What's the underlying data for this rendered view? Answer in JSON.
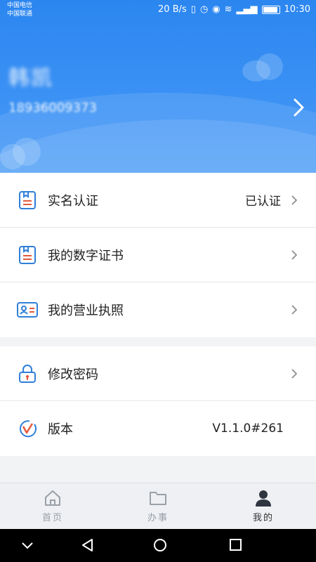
{
  "status_bar": {
    "carrier1": "中国电信",
    "carrier2": "中国联通",
    "speed": "20 B/s",
    "time": "10:30"
  },
  "profile": {
    "name": "韩凯",
    "phone": "18936009373"
  },
  "menu_group1": [
    {
      "label": "实名认证",
      "value": "已认证",
      "icon": "id-badge-icon"
    },
    {
      "label": "我的数字证书",
      "value": "",
      "icon": "certificate-icon"
    },
    {
      "label": "我的营业执照",
      "value": "",
      "icon": "license-card-icon"
    }
  ],
  "menu_group2": [
    {
      "label": "修改密码",
      "value": "",
      "icon": "lock-icon"
    },
    {
      "label": "版本",
      "value": "V1.1.0#261",
      "icon": "version-logo-icon"
    }
  ],
  "tabs": [
    {
      "label": "首页",
      "icon": "home-icon",
      "active": false
    },
    {
      "label": "办事",
      "icon": "folder-icon",
      "active": false
    },
    {
      "label": "我的",
      "icon": "user-icon",
      "active": true
    }
  ],
  "colors": {
    "header_blue": "#3b91f4",
    "icon_blue": "#2f7fd8",
    "icon_red": "#e35a3c",
    "active_tab": "#2f3640"
  }
}
